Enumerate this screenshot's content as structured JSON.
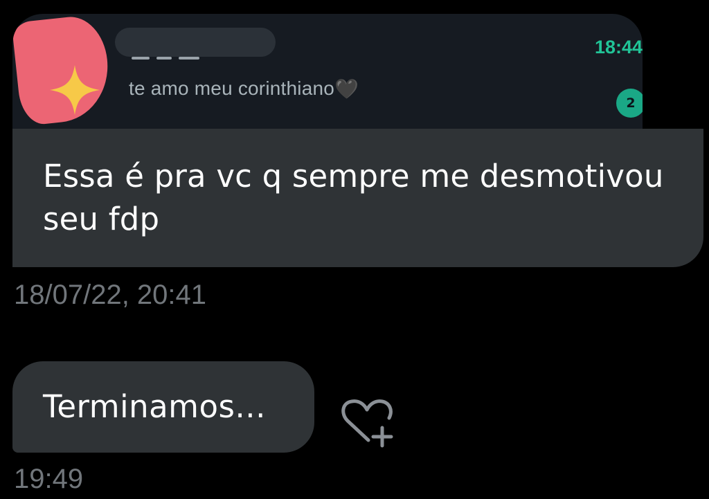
{
  "preview": {
    "last_message": "te amo meu corinthiano",
    "heart_emoji": "🖤",
    "time": "18:44",
    "unread_count": "2"
  },
  "messages": [
    {
      "text": "Essa é pra vc q sempre me desmotivou seu fdp",
      "timestamp": "18/07/22, 20:41"
    },
    {
      "text": "Terminamos...",
      "timestamp": "19:49"
    }
  ],
  "colors": {
    "background": "#000000",
    "bubble": "#2f3336",
    "timestamp": "#71767b",
    "accent_green": "#21c497",
    "avatar_pink": "#ec6574",
    "sparkle_yellow": "#f7c948"
  },
  "icons": {
    "avatar_decoration": "sparkle-icon",
    "reaction": "heart-plus-icon"
  }
}
